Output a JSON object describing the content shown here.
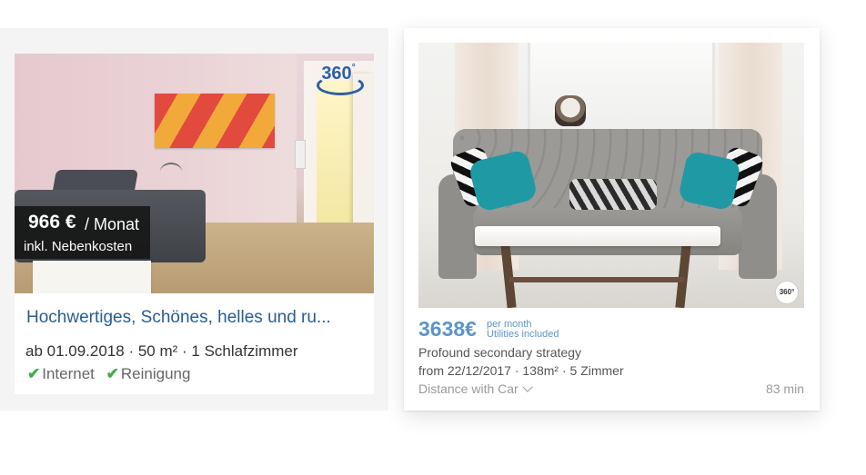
{
  "listings": [
    {
      "price": "966 €",
      "price_period": "/ Monat",
      "price_note": "inkl. Nebenkosten",
      "badge_360": "360",
      "title": "Hochwertiges, Schönes, helles und ru...",
      "details": "ab 01.09.2018 · 50 m² · 1 Schlafzimmer",
      "amenities": [
        "Internet",
        "Reinigung"
      ],
      "check_glyph": "✔"
    },
    {
      "price": "3638€",
      "price_period": "per month",
      "price_note": "Utilities included",
      "badge_360": "360°",
      "subtitle": "Profound secondary strategy",
      "details": "from 22/12/2017 · 138m² · 5 Zimmer",
      "distance_label": "Distance with Car",
      "duration": "83 min"
    }
  ],
  "colors": {
    "link_blue": "#2a5d93",
    "price_blue": "#5b95c8",
    "check_green": "#3fae49",
    "badge_blue": "#2f5fa8"
  },
  "icons": [
    "360-view-icon",
    "check-icon",
    "chevron-down-icon"
  ]
}
